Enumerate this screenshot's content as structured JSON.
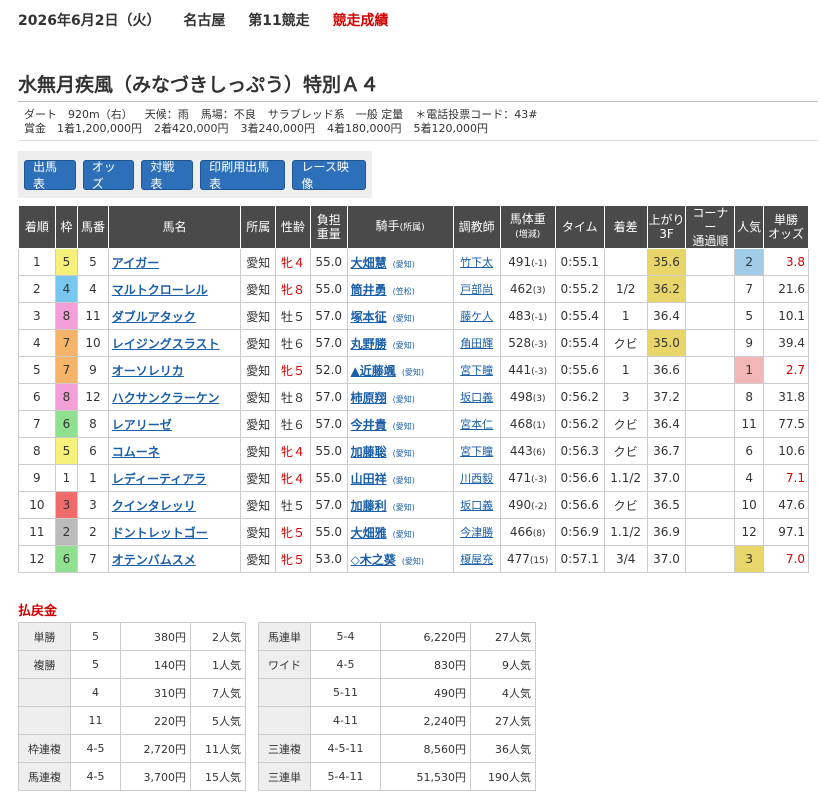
{
  "header": {
    "date": "2026年6月2日（火）",
    "venue": "名古屋",
    "race_no": "第11競走",
    "result_label": "競走成績"
  },
  "race": {
    "title": "水無月疾風（みなづきしっぷう）特別Ａ４",
    "info_line1": [
      "ダート　920m（右）",
      "天候：雨",
      "馬場：不良",
      "サラブレッド系　一般 定量",
      "＊電話投票コード：43#"
    ],
    "info_line2": [
      "賞金　1着1,200,000円",
      "2着420,000円",
      "3着240,000円",
      "4着180,000円",
      "5着120,000円"
    ]
  },
  "buttons": [
    "出馬表",
    "オッズ",
    "対戦表",
    "印刷用出馬表",
    "レース映像"
  ],
  "columns": {
    "rank": "着順",
    "frame": "枠",
    "num": "馬番",
    "name": "馬名",
    "belong": "所属",
    "sexage": "性齢",
    "load1": "負担",
    "load2": "重量",
    "jockey": "騎手",
    "jockey_sub": "(所属)",
    "trainer": "調教師",
    "weight1": "馬体重",
    "weight2": "(増減)",
    "time": "タイム",
    "margin": "着差",
    "last1": "上がり",
    "last2": "3F",
    "corner1": "コーナー",
    "corner2": "通過順",
    "pop": "人気",
    "odds1": "単勝",
    "odds2": "オッズ"
  },
  "colors": {
    "frame": {
      "1": "#ffffff",
      "2": "#bbbbbb",
      "3": "#f06c6c",
      "4": "#79c7f0",
      "5": "#f5f07a",
      "6": "#8fe08f",
      "7": "#f5b46a",
      "8": "#f3a0d8"
    },
    "header_bg": "#4a4a4a",
    "link": "#1a5fa8",
    "accent_red": "#d40000",
    "button_blue": "#2d6fb8"
  },
  "rows": [
    {
      "rank": "1",
      "frame": "5",
      "num": "5",
      "name": "アイガー",
      "belong": "愛知",
      "sexage": "牝４",
      "female": true,
      "load": "55.0",
      "jockey": "大畑慧",
      "aff": "(愛知)",
      "trainer": "竹下太",
      "weight": "491",
      "diff": "(-1)",
      "time": "0:55.1",
      "margin": "",
      "last": "35.6",
      "last_hl": true,
      "corner": "",
      "pop": "2",
      "pop_hl": "pop-hl",
      "odds": "3.8",
      "odds_red": true
    },
    {
      "rank": "2",
      "frame": "4",
      "num": "4",
      "name": "マルトクローレル",
      "belong": "愛知",
      "sexage": "牝８",
      "female": true,
      "load": "55.0",
      "jockey": "筒井勇",
      "aff": "(笠松)",
      "trainer": "戸部尚",
      "weight": "462",
      "diff": "(3)",
      "time": "0:55.2",
      "margin": "1/2",
      "last": "36.2",
      "last_hl": true,
      "corner": "",
      "pop": "7",
      "pop_hl": "",
      "odds": "21.6",
      "odds_red": false
    },
    {
      "rank": "3",
      "frame": "8",
      "num": "11",
      "name": "ダブルアタック",
      "belong": "愛知",
      "sexage": "牡５",
      "female": false,
      "load": "57.0",
      "jockey": "塚本征",
      "aff": "(愛知)",
      "trainer": "藤ケ人",
      "weight": "483",
      "diff": "(-1)",
      "time": "0:55.4",
      "margin": "1",
      "last": "36.4",
      "last_hl": false,
      "corner": "",
      "pop": "5",
      "pop_hl": "",
      "odds": "10.1",
      "odds_red": false
    },
    {
      "rank": "4",
      "frame": "7",
      "num": "10",
      "name": "レイジングスラスト",
      "belong": "愛知",
      "sexage": "牡６",
      "female": false,
      "load": "57.0",
      "jockey": "丸野勝",
      "aff": "(愛知)",
      "trainer": "角田輝",
      "weight": "528",
      "diff": "(-3)",
      "time": "0:55.4",
      "margin": "クビ",
      "last": "35.0",
      "last_hl": true,
      "corner": "",
      "pop": "9",
      "pop_hl": "",
      "odds": "39.4",
      "odds_red": false
    },
    {
      "rank": "5",
      "frame": "7",
      "num": "9",
      "name": "オーソレリカ",
      "belong": "愛知",
      "sexage": "牝５",
      "female": true,
      "load": "52.0",
      "jockey": "▲近藤颯",
      "aff": "(愛知)",
      "trainer": "宮下瞳",
      "weight": "441",
      "diff": "(-3)",
      "time": "0:55.6",
      "margin": "1",
      "last": "36.6",
      "last_hl": false,
      "corner": "",
      "pop": "1",
      "pop_hl": "pop-hl2",
      "odds": "2.7",
      "odds_red": true
    },
    {
      "rank": "6",
      "frame": "8",
      "num": "12",
      "name": "ハクサンクラーケン",
      "belong": "愛知",
      "sexage": "牡８",
      "female": false,
      "load": "57.0",
      "jockey": "柿原翔",
      "aff": "(愛知)",
      "trainer": "坂口義",
      "weight": "498",
      "diff": "(3)",
      "time": "0:56.2",
      "margin": "3",
      "last": "37.2",
      "last_hl": false,
      "corner": "",
      "pop": "8",
      "pop_hl": "",
      "odds": "31.8",
      "odds_red": false
    },
    {
      "rank": "7",
      "frame": "6",
      "num": "8",
      "name": "レアリーゼ",
      "belong": "愛知",
      "sexage": "牡６",
      "female": false,
      "load": "57.0",
      "jockey": "今井貴",
      "aff": "(愛知)",
      "trainer": "宮本仁",
      "weight": "468",
      "diff": "(1)",
      "time": "0:56.2",
      "margin": "クビ",
      "last": "36.4",
      "last_hl": false,
      "corner": "",
      "pop": "11",
      "pop_hl": "",
      "odds": "77.5",
      "odds_red": false
    },
    {
      "rank": "8",
      "frame": "5",
      "num": "6",
      "name": "コムーネ",
      "belong": "愛知",
      "sexage": "牝４",
      "female": true,
      "load": "55.0",
      "jockey": "加藤聡",
      "aff": "(愛知)",
      "trainer": "宮下瞳",
      "weight": "443",
      "diff": "(6)",
      "time": "0:56.3",
      "margin": "クビ",
      "last": "36.7",
      "last_hl": false,
      "corner": "",
      "pop": "6",
      "pop_hl": "",
      "odds": "10.6",
      "odds_red": false
    },
    {
      "rank": "9",
      "frame": "1",
      "num": "1",
      "name": "レディーティアラ",
      "belong": "愛知",
      "sexage": "牝４",
      "female": true,
      "load": "55.0",
      "jockey": "山田祥",
      "aff": "(愛知)",
      "trainer": "川西毅",
      "weight": "471",
      "diff": "(-3)",
      "time": "0:56.6",
      "margin": "1.1/2",
      "last": "37.0",
      "last_hl": false,
      "corner": "",
      "pop": "4",
      "pop_hl": "",
      "odds": "7.1",
      "odds_red": true
    },
    {
      "rank": "10",
      "frame": "3",
      "num": "3",
      "name": "クインタレッリ",
      "belong": "愛知",
      "sexage": "牡５",
      "female": false,
      "load": "57.0",
      "jockey": "加藤利",
      "aff": "(愛知)",
      "trainer": "坂口義",
      "weight": "490",
      "diff": "(-2)",
      "time": "0:56.6",
      "margin": "クビ",
      "last": "36.5",
      "last_hl": false,
      "corner": "",
      "pop": "10",
      "pop_hl": "",
      "odds": "47.6",
      "odds_red": false
    },
    {
      "rank": "11",
      "frame": "2",
      "num": "2",
      "name": "ドントレットゴー",
      "belong": "愛知",
      "sexage": "牝５",
      "female": true,
      "load": "55.0",
      "jockey": "大畑雅",
      "aff": "(愛知)",
      "trainer": "今津勝",
      "weight": "466",
      "diff": "(8)",
      "time": "0:56.9",
      "margin": "1.1/2",
      "last": "36.9",
      "last_hl": false,
      "corner": "",
      "pop": "12",
      "pop_hl": "",
      "odds": "97.1",
      "odds_red": false
    },
    {
      "rank": "12",
      "frame": "6",
      "num": "7",
      "name": "オテンバムスメ",
      "belong": "愛知",
      "sexage": "牝５",
      "female": true,
      "load": "53.0",
      "jockey": "◇木之葵",
      "aff": "(愛知)",
      "trainer": "榎屋充",
      "weight": "477",
      "diff": "(15)",
      "time": "0:57.1",
      "margin": "3/4",
      "last": "37.0",
      "last_hl": false,
      "corner": "",
      "pop": "3",
      "pop_hl": "pop-hl3",
      "odds": "7.0",
      "odds_red": true
    }
  ],
  "payout": {
    "title": "払戻金",
    "left": [
      {
        "type": "単勝",
        "combo": "5",
        "amount": "380円",
        "pop": "2人気"
      },
      {
        "type": "複勝",
        "combo": "5",
        "amount": "140円",
        "pop": "1人気"
      },
      {
        "type": "",
        "combo": "4",
        "amount": "310円",
        "pop": "7人気"
      },
      {
        "type": "",
        "combo": "11",
        "amount": "220円",
        "pop": "5人気"
      },
      {
        "type": "枠連複",
        "combo": "4-5",
        "amount": "2,720円",
        "pop": "11人気"
      },
      {
        "type": "馬連複",
        "combo": "4-5",
        "amount": "3,700円",
        "pop": "15人気"
      }
    ],
    "right": [
      {
        "type": "馬連単",
        "combo": "5-4",
        "amount": "6,220円",
        "pop": "27人気"
      },
      {
        "type": "ワイド",
        "combo": "4-5",
        "amount": "830円",
        "pop": "9人気"
      },
      {
        "type": "",
        "combo": "5-11",
        "amount": "490円",
        "pop": "4人気"
      },
      {
        "type": "",
        "combo": "4-11",
        "amount": "2,240円",
        "pop": "27人気"
      },
      {
        "type": "三連複",
        "combo": "4-5-11",
        "amount": "8,560円",
        "pop": "36人気"
      },
      {
        "type": "三連単",
        "combo": "5-4-11",
        "amount": "51,530円",
        "pop": "190人気"
      }
    ]
  }
}
